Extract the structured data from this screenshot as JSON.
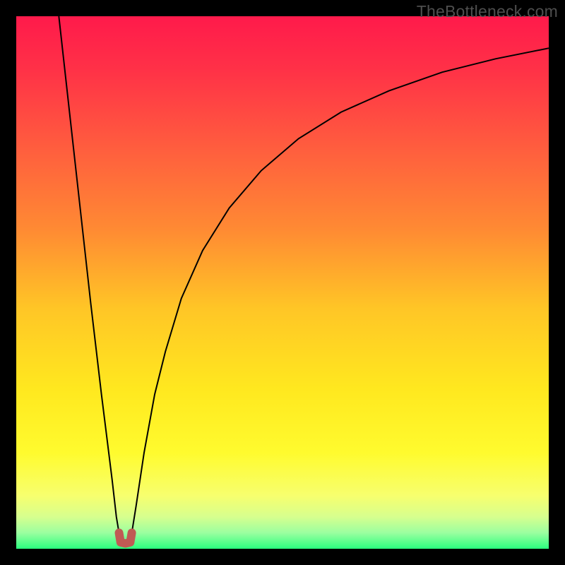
{
  "watermark": "TheBottleneck.com",
  "chart_data": {
    "type": "line",
    "title": "",
    "xlabel": "",
    "ylabel": "",
    "xlim": [
      0,
      100
    ],
    "ylim": [
      0,
      100
    ],
    "grid": false,
    "legend": false,
    "background": {
      "type": "vertical-gradient",
      "stops": [
        {
          "offset": 0.0,
          "color": "#ff1a4b"
        },
        {
          "offset": 0.1,
          "color": "#ff3147"
        },
        {
          "offset": 0.25,
          "color": "#ff5e3e"
        },
        {
          "offset": 0.4,
          "color": "#ff8a33"
        },
        {
          "offset": 0.55,
          "color": "#ffc626"
        },
        {
          "offset": 0.7,
          "color": "#ffe81f"
        },
        {
          "offset": 0.82,
          "color": "#fffb2e"
        },
        {
          "offset": 0.9,
          "color": "#f7ff6e"
        },
        {
          "offset": 0.94,
          "color": "#d7ff8e"
        },
        {
          "offset": 0.97,
          "color": "#9bffa0"
        },
        {
          "offset": 1.0,
          "color": "#2bff7e"
        }
      ]
    },
    "series": [
      {
        "name": "left-branch",
        "stroke": "#000000",
        "stroke_width": 2,
        "x": [
          8.0,
          9.0,
          10.0,
          11.0,
          12.0,
          13.0,
          14.0,
          15.0,
          16.0,
          17.0,
          18.0,
          18.8,
          19.3
        ],
        "y": [
          100.0,
          91.0,
          82.0,
          73.0,
          64.0,
          55.0,
          46.0,
          37.5,
          29.0,
          21.0,
          13.0,
          6.0,
          3.0
        ]
      },
      {
        "name": "right-branch",
        "stroke": "#000000",
        "stroke_width": 2,
        "x": [
          21.7,
          22.5,
          24.0,
          26.0,
          28.0,
          31.0,
          35.0,
          40.0,
          46.0,
          53.0,
          61.0,
          70.0,
          80.0,
          90.0,
          100.0
        ],
        "y": [
          3.0,
          8.0,
          18.0,
          29.0,
          37.0,
          47.0,
          56.0,
          64.0,
          71.0,
          77.0,
          82.0,
          86.0,
          89.5,
          92.0,
          94.0
        ]
      },
      {
        "name": "minimum-marker",
        "type": "path",
        "stroke": "#c05a54",
        "stroke_width": 12,
        "linecap": "round",
        "x": [
          19.3,
          19.6,
          20.5,
          21.4,
          21.7
        ],
        "y": [
          3.0,
          1.2,
          1.0,
          1.2,
          3.0
        ]
      }
    ],
    "annotations": []
  }
}
